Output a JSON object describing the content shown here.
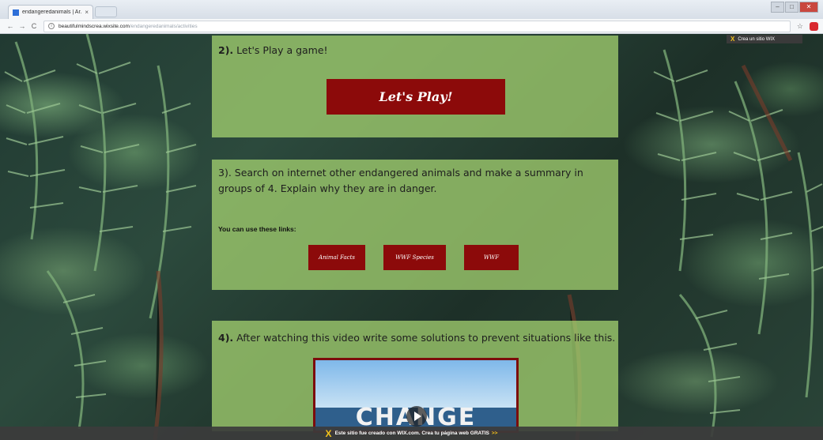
{
  "browser": {
    "tab_title": "endangeredanimals | Ar...",
    "tab_close": "×",
    "url_host": "beautifulmindscrea.wixsite.com",
    "url_path": "/endangeredanimals/activities",
    "nav": {
      "back": "←",
      "forward": "→",
      "reload": "C"
    },
    "star": "☆",
    "window_buttons": {
      "minimize": "–",
      "maximize": "□",
      "close": "✕"
    }
  },
  "wix_top_badge": {
    "icon": "X",
    "label": "Crea un sitio WIX"
  },
  "section2": {
    "number": "2).",
    "title": " Let's Play a game!",
    "button_label": "Let's Play!"
  },
  "section3": {
    "heading": "3). Search on internet other endangered animals and make a summary in groups of 4. Explain why they are in danger.",
    "links_label": "You can use these links:",
    "links": [
      "Animal Facts",
      "WWF Species",
      "WWF"
    ]
  },
  "section4": {
    "number": "4).",
    "title": " After watching this video write some solutions to prevent situations like this.",
    "video_title": "CHANGE"
  },
  "wix_banner": {
    "icon": "X",
    "text": "Este sitio fue creado con WIX.com. Crea tu página web GRATIS",
    "arrow": ">>"
  }
}
